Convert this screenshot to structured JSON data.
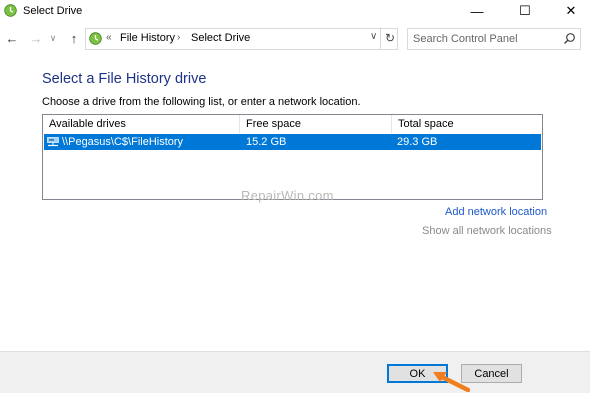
{
  "window": {
    "title": "Select Drive",
    "minimize_glyph": "—",
    "maximize_glyph": "☐",
    "close_glyph": "✕"
  },
  "nav": {
    "back_glyph": "←",
    "forward_glyph": "→",
    "recent_glyph": "∨",
    "up_glyph": "↑",
    "address_chevron": "«",
    "breadcrumbs": [
      "File History",
      "Select Drive"
    ],
    "separator": "›",
    "dropdown_glyph": "∨",
    "refresh_glyph": "↻",
    "search_placeholder": "Search Control Panel"
  },
  "main": {
    "heading": "Select a File History drive",
    "instruction": "Choose a drive from the following list, or enter a network location.",
    "table": {
      "columns": [
        "Available drives",
        "Free space",
        "Total space"
      ],
      "rows": [
        {
          "drive": "\\\\Pegasus\\C$\\FileHistory",
          "free": "15.2 GB",
          "total": "29.3 GB",
          "selected": true
        }
      ]
    },
    "watermark": "RepairWin.com",
    "add_network_location": "Add network location",
    "show_all_network_locations": "Show all network locations"
  },
  "footer": {
    "ok_label": "OK",
    "cancel_label": "Cancel"
  },
  "colors": {
    "heading": "#1e3287",
    "selection": "#0078d7",
    "link": "#1e5ac8",
    "annotation_arrow": "#f07d1e"
  }
}
